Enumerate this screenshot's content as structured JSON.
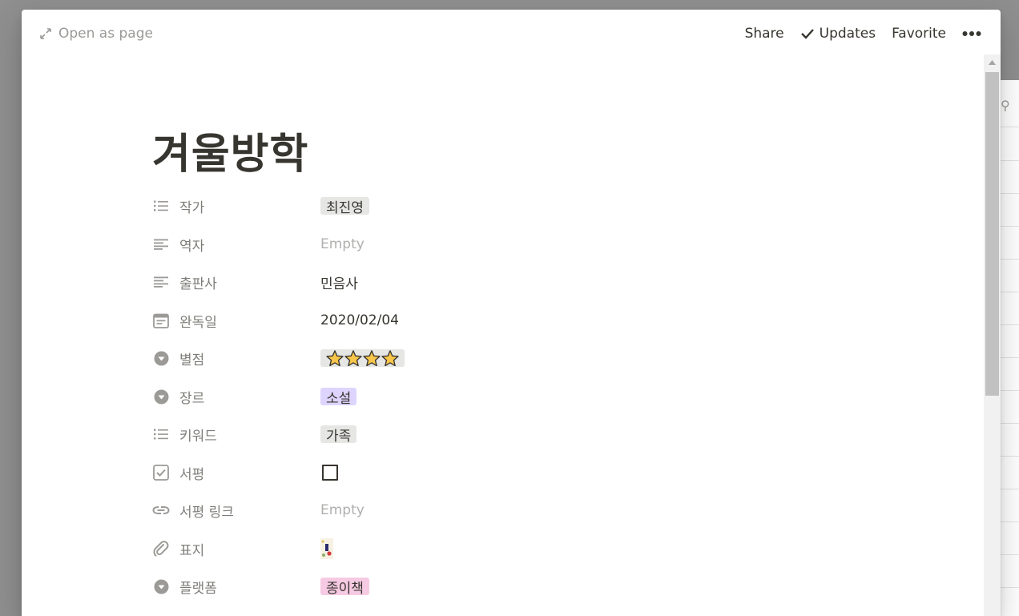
{
  "topbar": {
    "open_as_page": "Open as page",
    "share": "Share",
    "updates": "Updates",
    "favorite": "Favorite"
  },
  "page": {
    "title": "겨울방학"
  },
  "properties": [
    {
      "name": "작가",
      "icon": "list-icon",
      "type": "tags",
      "value": "최진영"
    },
    {
      "name": "역자",
      "icon": "text-icon",
      "type": "empty",
      "value": "Empty"
    },
    {
      "name": "출판사",
      "icon": "text-icon",
      "type": "text",
      "value": "민음사"
    },
    {
      "name": "완독일",
      "icon": "calendar-icon",
      "type": "text",
      "value": "2020/02/04"
    },
    {
      "name": "별점",
      "icon": "select-icon",
      "type": "stars",
      "value": 4
    },
    {
      "name": "장르",
      "icon": "select-icon",
      "type": "tag-purple",
      "value": "소설"
    },
    {
      "name": "키워드",
      "icon": "list-icon",
      "type": "tags",
      "value": "가족"
    },
    {
      "name": "서평",
      "icon": "checkbox-icon",
      "type": "checkbox",
      "value": false
    },
    {
      "name": "서평 링크",
      "icon": "link-icon",
      "type": "empty",
      "value": "Empty"
    },
    {
      "name": "표지",
      "icon": "attachment-icon",
      "type": "file",
      "value": ""
    },
    {
      "name": "플랫폼",
      "icon": "select-icon",
      "type": "tag-pink",
      "value": "종이책"
    }
  ],
  "colors": {
    "text": "#37352f",
    "muted": "#9b9a97",
    "tag_gray": "#e3e2e0",
    "tag_purple": "#dad0ff",
    "tag_pink": "#f5c4e0",
    "star": "#f7c64a"
  }
}
